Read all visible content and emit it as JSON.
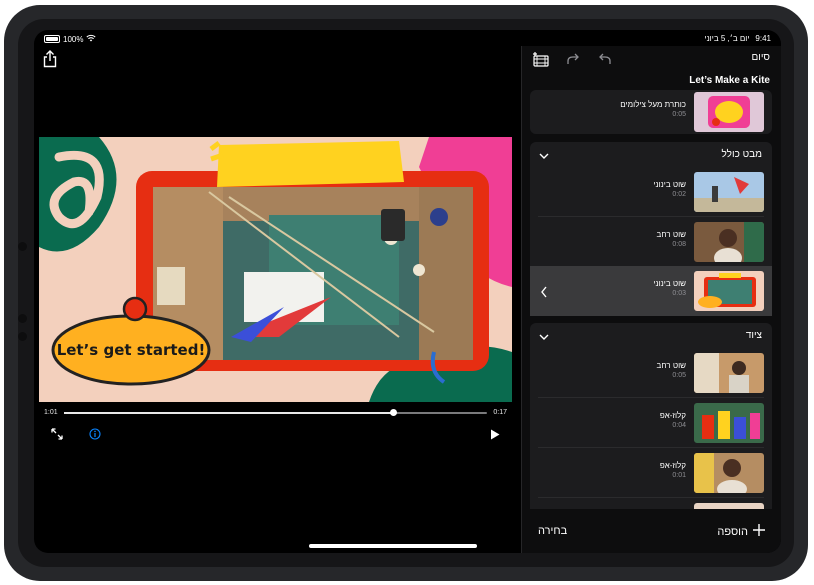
{
  "status": {
    "battery_pct": "100%",
    "time": "9:41",
    "date": "יום ב׳, 5 ביוני"
  },
  "player": {
    "caption": "Let’s get started!",
    "time_elapsed": "1:01",
    "time_remaining": "0:17",
    "progress": 0.78,
    "icons": [
      "share-icon",
      "fullscreen-icon",
      "info-icon",
      "play-icon"
    ]
  },
  "editor": {
    "done_label": "סיום",
    "project_title": "Let’s Make a Kite",
    "toolbar_icons": [
      "add-clip-icon",
      "redo-icon",
      "undo-icon"
    ],
    "top_clip": {
      "title": "כותרת מעל צילומים",
      "duration": "0:05"
    },
    "sections": [
      {
        "title": "מבט כולל",
        "clips": [
          {
            "title": "שוט בינוני",
            "duration": "0:02"
          },
          {
            "title": "שוט רחב",
            "duration": "0:08"
          },
          {
            "title": "שוט בינוני",
            "duration": "0:03",
            "selected": true
          }
        ]
      },
      {
        "title": "ציוד",
        "clips": [
          {
            "title": "שוט רחב",
            "duration": "0:05"
          },
          {
            "title": "קלוז-אפ",
            "duration": "0:04"
          },
          {
            "title": "קלוז-אפ",
            "duration": "0:01"
          }
        ]
      }
    ],
    "select_label": "בחירה",
    "add_label": "הוספה",
    "colors": {
      "accent": "#0a84ff",
      "panel": "#1c1c1e",
      "selected": "#3a3a3c"
    }
  }
}
